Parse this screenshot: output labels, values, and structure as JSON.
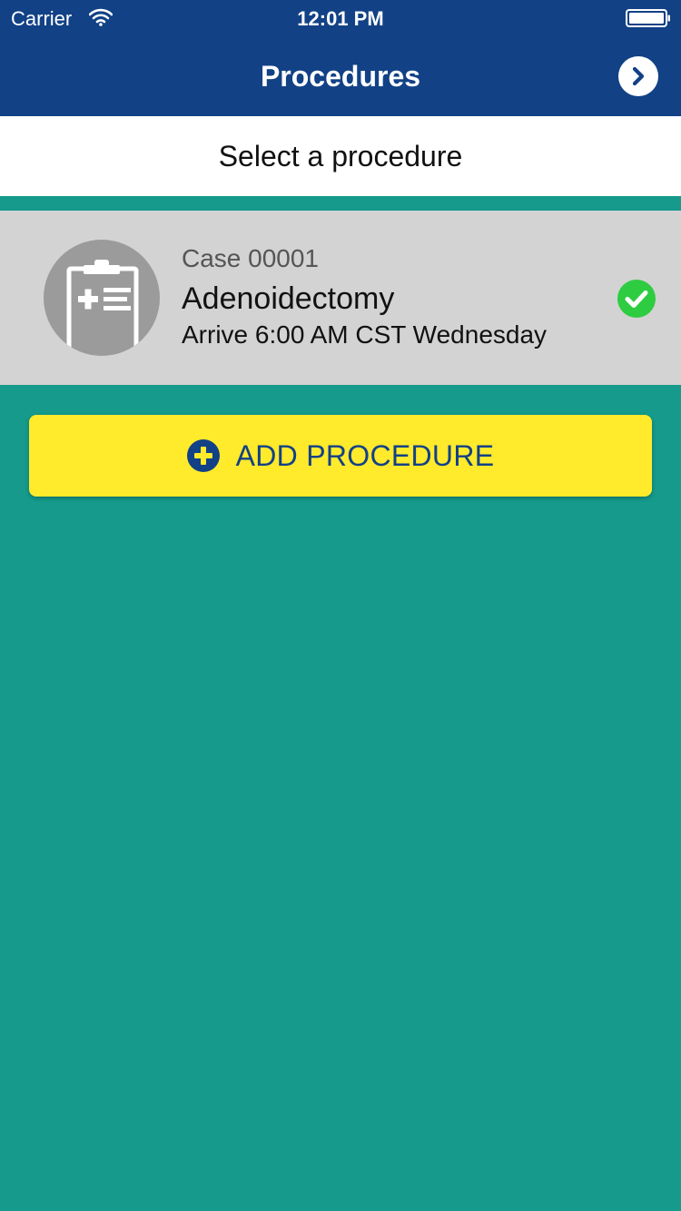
{
  "status_bar": {
    "carrier": "Carrier",
    "time": "12:01 PM"
  },
  "nav": {
    "title": "Procedures",
    "next_icon": "chevron-right-circle-icon"
  },
  "subtitle": "Select a procedure",
  "procedure": {
    "case_number": "Case 00001",
    "name": "Adenoidectomy",
    "arrival": "Arrive 6:00 AM CST Wednesday",
    "avatar_icon": "clipboard-icon",
    "status_icon": "check-circle-icon"
  },
  "add_button": {
    "label": "ADD PROCEDURE",
    "icon": "plus-circle-icon"
  },
  "colors": {
    "header": "#124186",
    "background": "#159a8b",
    "card": "#d3d3d3",
    "button": "#ffea2c",
    "check": "#2ecc40"
  }
}
